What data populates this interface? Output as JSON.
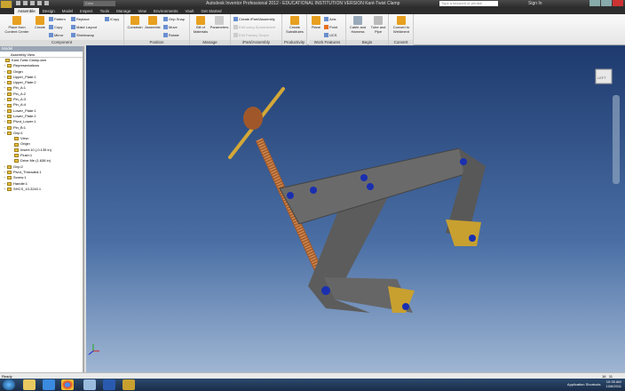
{
  "window": {
    "title": "Autodesk Inventor Professional 2012 - EDUCATIONAL INSTITUTION VERSION   Kant-Twist Clamp",
    "color_select": "Color",
    "search_placeholder": "Type a keyword or phrase",
    "sign_in": "Sign In"
  },
  "tabs": [
    "Assemble",
    "Design",
    "Model",
    "Inspect",
    "Tools",
    "Manage",
    "View",
    "Environments",
    "Vault",
    "Get Started"
  ],
  "ribbon": {
    "component": {
      "label": "Component",
      "place": "Place from Content Center",
      "create": "Create",
      "pattern": "Pattern",
      "copy": "Copy",
      "mirror": "Mirror",
      "replace": "Replace",
      "make_layout": "Make Layout",
      "shrinkwrap": "Shrinkwrap",
      "icopy": "iCopy"
    },
    "position": {
      "label": "Position",
      "constrain": "Constrain",
      "assemble": "Assemble",
      "grip_snap": "Grip Snap",
      "move": "Move",
      "rotate": "Rotate"
    },
    "manage": {
      "label": "Manage",
      "bom": "Bill of Materials",
      "parameters": "Parameters"
    },
    "ipart": {
      "label": "iPart/iAssembly",
      "create": "Create iPart/iAssembly",
      "edit_spreadsheet": "Edit using Spreadsheet",
      "edit_factory": "Edit Factory Scope"
    },
    "productivity": {
      "label": "Productivity",
      "create_substitutes": "Create Substitutes"
    },
    "work_features": {
      "label": "Work Features",
      "plane": "Plane",
      "axis": "Axis",
      "point": "Point",
      "ucs": "UCS"
    },
    "begin": {
      "label": "Begin",
      "cable": "Cable and Harness",
      "tube": "Tube and Pipe"
    },
    "convert": {
      "label": "Convert",
      "weldment": "Convert to Weldment"
    }
  },
  "browser": {
    "header": "Model",
    "view": "Assembly View",
    "root": "Kant-Twist Clamp.iam",
    "nodes": [
      "Representations",
      "Origin",
      "Upper_Plate:1",
      "Upper_Plate:2",
      "Pin_A:1",
      "Pin_A:2",
      "Pin_A:3",
      "Pin_A:4",
      "Lower_Plate:1",
      "Lower_Plate:2",
      "Pivot_Lower:1",
      "Pin_B:1",
      "Grip:1"
    ],
    "grip_children": [
      "View:",
      "Origin",
      "Insert:10 (-0.135 in)",
      "Flush:1",
      "Drive Me (1.638 in)"
    ],
    "after": [
      "Grip:2",
      "Pivot_Threaded:1",
      "Screw:1",
      "Handle:1",
      "SHCS_10-32x0.1"
    ]
  },
  "status": {
    "text": "Ready",
    "num1": "16",
    "num2": "11"
  },
  "taskbar": {
    "tray_label": "Application Shortcuts",
    "time": "10:35 AM",
    "date": "10/6/2011"
  },
  "viewcube": {
    "label": "LEFT"
  },
  "colors": {
    "viewport_top": "#1e3a6e",
    "viewport_bottom": "#9fb6d3",
    "part_gray": "#5a5a5a",
    "pin_blue": "#1a2fb0",
    "brass": "#d4a838",
    "copper": "#a0582a"
  }
}
